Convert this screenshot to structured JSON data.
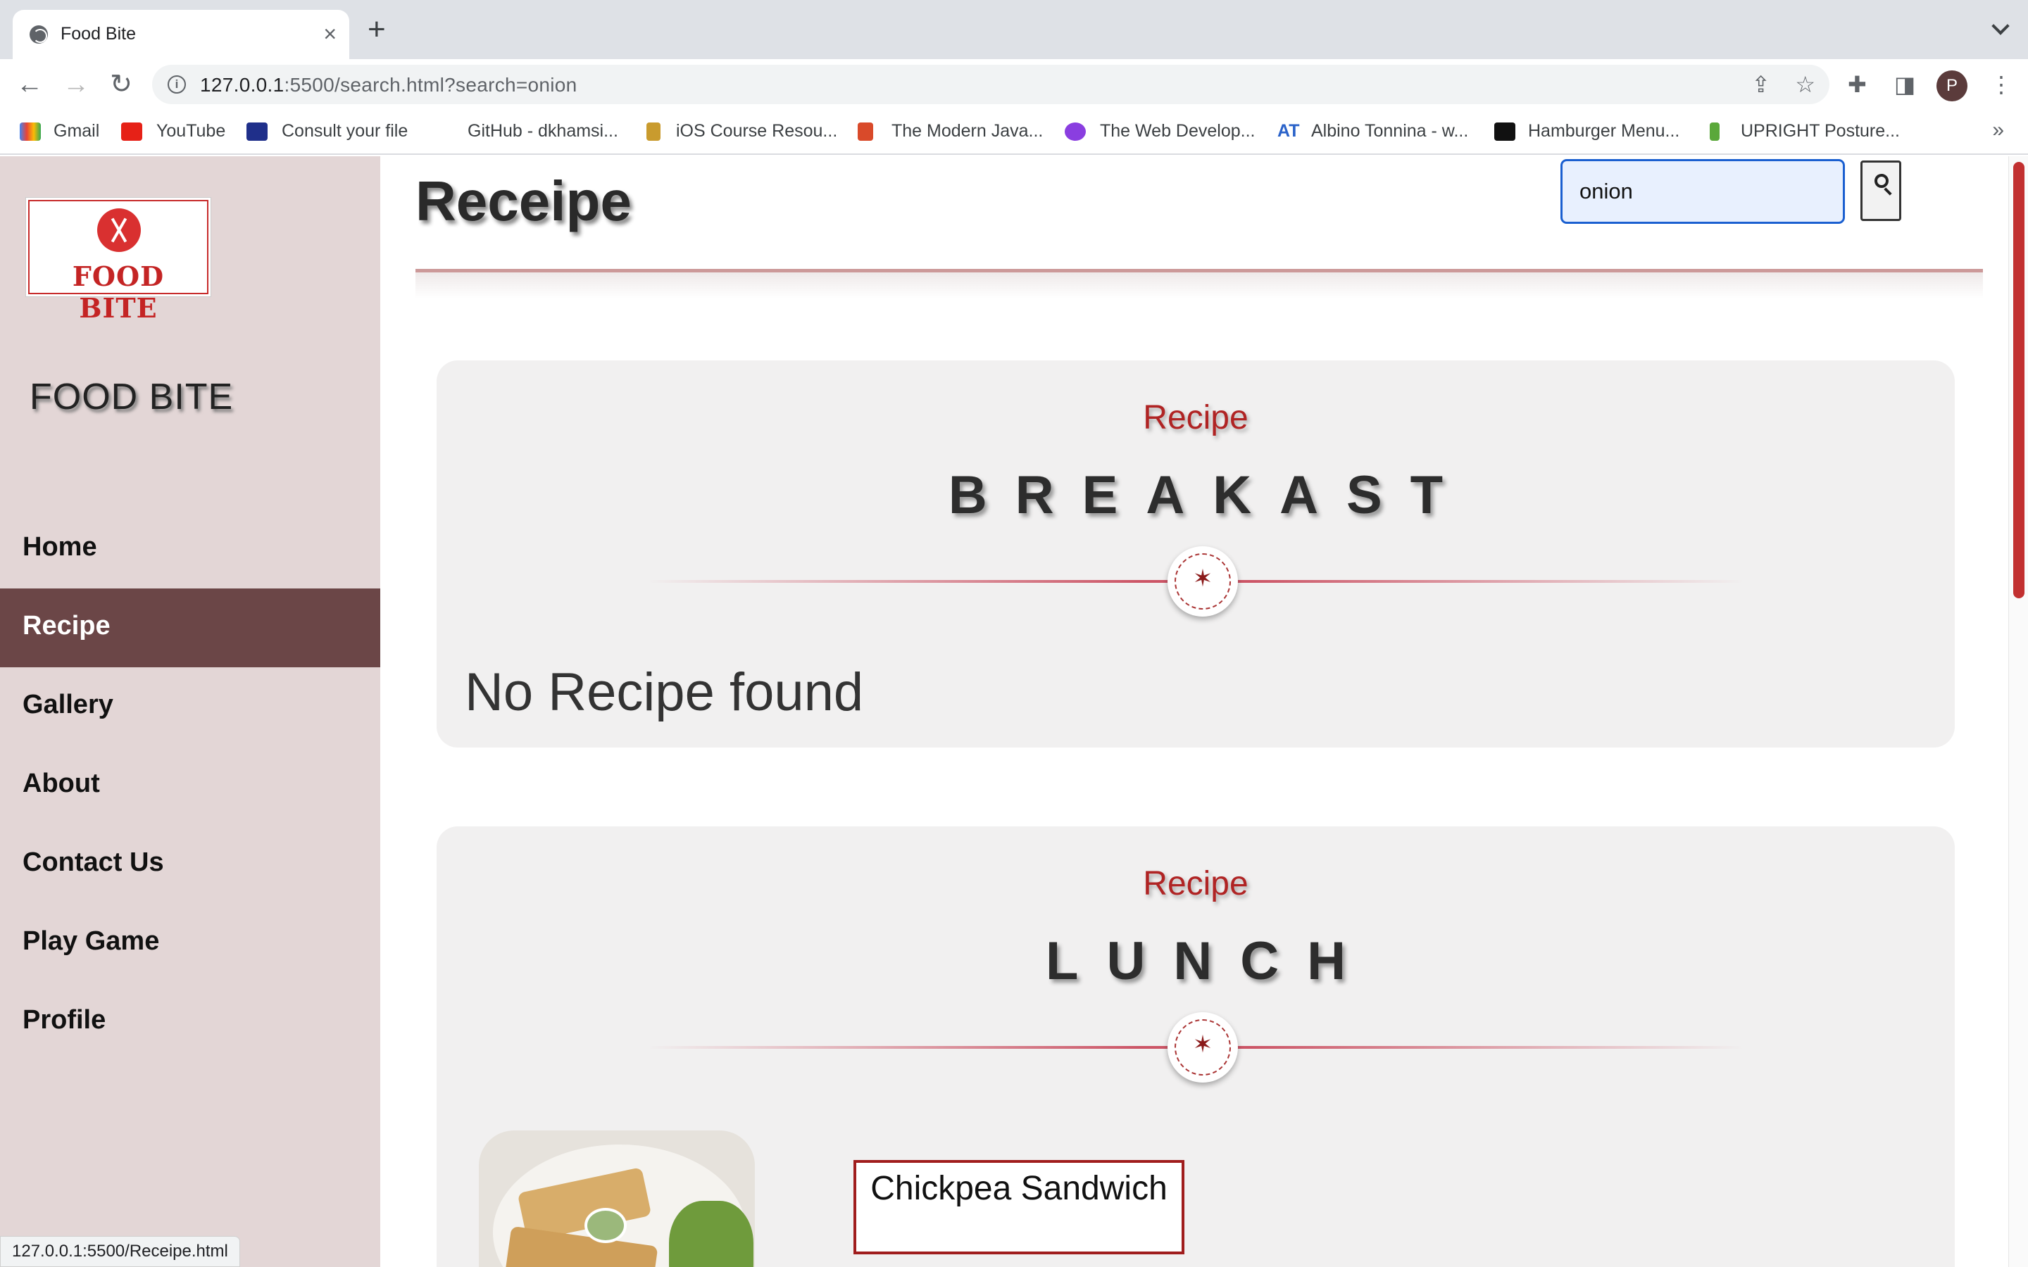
{
  "browser": {
    "tab_title": "Food Bite",
    "url_host": "127.0.0.1",
    "url_rest": ":5500/search.html?search=onion",
    "bookmarks": [
      "Gmail",
      "YouTube",
      "Consult your file",
      "GitHub - dkhamsi...",
      "iOS Course Resou...",
      "The Modern Java...",
      "The Web Develop...",
      "Albino Tonnina - w...",
      "Hamburger Menu...",
      "UPRIGHT Posture..."
    ],
    "profile_initial": "P",
    "status_url": "127.0.0.1:5500/Receipe.html",
    "at_label": "AT"
  },
  "sidebar": {
    "logo_text": "FOOD BITE",
    "brand": "FOOD BITE",
    "items": [
      "Home",
      "Recipe",
      "Gallery",
      "About",
      "Contact Us",
      "Play Game",
      "Profile"
    ],
    "active": "Recipe"
  },
  "main": {
    "title": "Receipe",
    "search_value": "onion"
  },
  "sections": [
    {
      "kicker": "Recipe",
      "heading": "BREAKAST",
      "message": "No Recipe found"
    },
    {
      "kicker": "Recipe",
      "heading": "LUNCH",
      "recipe_name": "Chickpea Sandwich"
    }
  ],
  "divider_glyph": "✶",
  "colors": {
    "accent": "#b02424",
    "active_nav": "#6b4647",
    "sidebar_bg": "#e3d6d6",
    "card_bg": "#f1f0f0"
  }
}
